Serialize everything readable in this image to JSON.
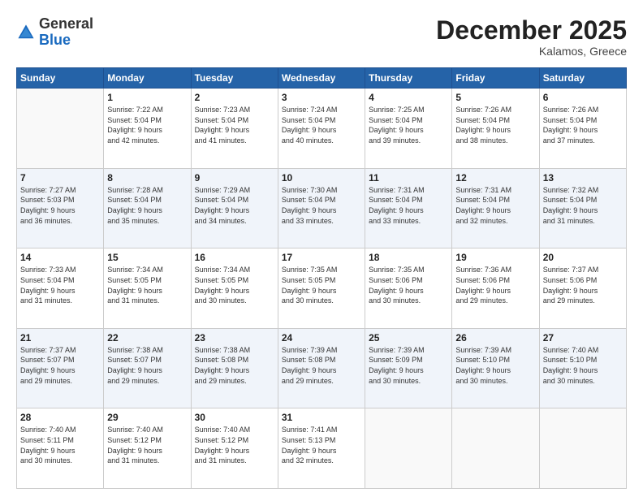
{
  "header": {
    "logo_general": "General",
    "logo_blue": "Blue",
    "month_title": "December 2025",
    "location": "Kalamos, Greece"
  },
  "weekdays": [
    "Sunday",
    "Monday",
    "Tuesday",
    "Wednesday",
    "Thursday",
    "Friday",
    "Saturday"
  ],
  "weeks": [
    [
      {
        "day": "",
        "info": ""
      },
      {
        "day": "1",
        "info": "Sunrise: 7:22 AM\nSunset: 5:04 PM\nDaylight: 9 hours\nand 42 minutes."
      },
      {
        "day": "2",
        "info": "Sunrise: 7:23 AM\nSunset: 5:04 PM\nDaylight: 9 hours\nand 41 minutes."
      },
      {
        "day": "3",
        "info": "Sunrise: 7:24 AM\nSunset: 5:04 PM\nDaylight: 9 hours\nand 40 minutes."
      },
      {
        "day": "4",
        "info": "Sunrise: 7:25 AM\nSunset: 5:04 PM\nDaylight: 9 hours\nand 39 minutes."
      },
      {
        "day": "5",
        "info": "Sunrise: 7:26 AM\nSunset: 5:04 PM\nDaylight: 9 hours\nand 38 minutes."
      },
      {
        "day": "6",
        "info": "Sunrise: 7:26 AM\nSunset: 5:04 PM\nDaylight: 9 hours\nand 37 minutes."
      }
    ],
    [
      {
        "day": "7",
        "info": "Sunrise: 7:27 AM\nSunset: 5:03 PM\nDaylight: 9 hours\nand 36 minutes."
      },
      {
        "day": "8",
        "info": "Sunrise: 7:28 AM\nSunset: 5:04 PM\nDaylight: 9 hours\nand 35 minutes."
      },
      {
        "day": "9",
        "info": "Sunrise: 7:29 AM\nSunset: 5:04 PM\nDaylight: 9 hours\nand 34 minutes."
      },
      {
        "day": "10",
        "info": "Sunrise: 7:30 AM\nSunset: 5:04 PM\nDaylight: 9 hours\nand 33 minutes."
      },
      {
        "day": "11",
        "info": "Sunrise: 7:31 AM\nSunset: 5:04 PM\nDaylight: 9 hours\nand 33 minutes."
      },
      {
        "day": "12",
        "info": "Sunrise: 7:31 AM\nSunset: 5:04 PM\nDaylight: 9 hours\nand 32 minutes."
      },
      {
        "day": "13",
        "info": "Sunrise: 7:32 AM\nSunset: 5:04 PM\nDaylight: 9 hours\nand 31 minutes."
      }
    ],
    [
      {
        "day": "14",
        "info": "Sunrise: 7:33 AM\nSunset: 5:04 PM\nDaylight: 9 hours\nand 31 minutes."
      },
      {
        "day": "15",
        "info": "Sunrise: 7:34 AM\nSunset: 5:05 PM\nDaylight: 9 hours\nand 31 minutes."
      },
      {
        "day": "16",
        "info": "Sunrise: 7:34 AM\nSunset: 5:05 PM\nDaylight: 9 hours\nand 30 minutes."
      },
      {
        "day": "17",
        "info": "Sunrise: 7:35 AM\nSunset: 5:05 PM\nDaylight: 9 hours\nand 30 minutes."
      },
      {
        "day": "18",
        "info": "Sunrise: 7:35 AM\nSunset: 5:06 PM\nDaylight: 9 hours\nand 30 minutes."
      },
      {
        "day": "19",
        "info": "Sunrise: 7:36 AM\nSunset: 5:06 PM\nDaylight: 9 hours\nand 29 minutes."
      },
      {
        "day": "20",
        "info": "Sunrise: 7:37 AM\nSunset: 5:06 PM\nDaylight: 9 hours\nand 29 minutes."
      }
    ],
    [
      {
        "day": "21",
        "info": "Sunrise: 7:37 AM\nSunset: 5:07 PM\nDaylight: 9 hours\nand 29 minutes."
      },
      {
        "day": "22",
        "info": "Sunrise: 7:38 AM\nSunset: 5:07 PM\nDaylight: 9 hours\nand 29 minutes."
      },
      {
        "day": "23",
        "info": "Sunrise: 7:38 AM\nSunset: 5:08 PM\nDaylight: 9 hours\nand 29 minutes."
      },
      {
        "day": "24",
        "info": "Sunrise: 7:39 AM\nSunset: 5:08 PM\nDaylight: 9 hours\nand 29 minutes."
      },
      {
        "day": "25",
        "info": "Sunrise: 7:39 AM\nSunset: 5:09 PM\nDaylight: 9 hours\nand 30 minutes."
      },
      {
        "day": "26",
        "info": "Sunrise: 7:39 AM\nSunset: 5:10 PM\nDaylight: 9 hours\nand 30 minutes."
      },
      {
        "day": "27",
        "info": "Sunrise: 7:40 AM\nSunset: 5:10 PM\nDaylight: 9 hours\nand 30 minutes."
      }
    ],
    [
      {
        "day": "28",
        "info": "Sunrise: 7:40 AM\nSunset: 5:11 PM\nDaylight: 9 hours\nand 30 minutes."
      },
      {
        "day": "29",
        "info": "Sunrise: 7:40 AM\nSunset: 5:12 PM\nDaylight: 9 hours\nand 31 minutes."
      },
      {
        "day": "30",
        "info": "Sunrise: 7:40 AM\nSunset: 5:12 PM\nDaylight: 9 hours\nand 31 minutes."
      },
      {
        "day": "31",
        "info": "Sunrise: 7:41 AM\nSunset: 5:13 PM\nDaylight: 9 hours\nand 32 minutes."
      },
      {
        "day": "",
        "info": ""
      },
      {
        "day": "",
        "info": ""
      },
      {
        "day": "",
        "info": ""
      }
    ]
  ]
}
